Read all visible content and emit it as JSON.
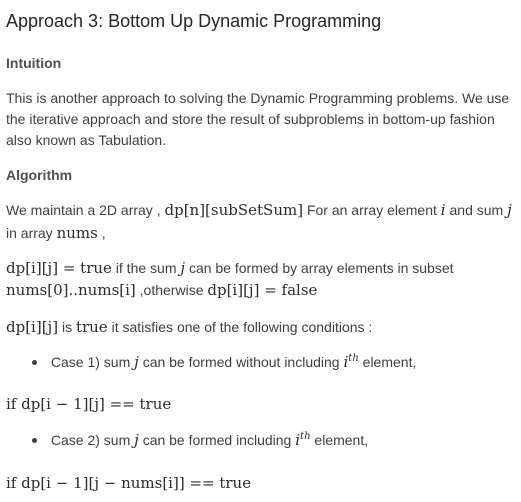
{
  "title": "Approach 3: Bottom Up Dynamic Programming",
  "intuition": {
    "heading": "Intuition",
    "paragraph": "This is another approach to solving the Dynamic Programming problems. We use the iterative approach and store the result of subproblems in bottom-up fashion also known as Tabulation."
  },
  "algorithm": {
    "heading": "Algorithm",
    "line1": {
      "prefix": "We maintain a 2D array , ",
      "math_dp": "dp[n][subSetSum]",
      "mid": " For an array element ",
      "var_i": "i",
      "and_sum": " and sum ",
      "var_j": "j"
    },
    "line2": {
      "prefix": "in array ",
      "nums": "nums",
      "suffix": ","
    },
    "def": {
      "lhs": "dp[i][j] = true",
      "text1": " if the sum ",
      "var_j": "j",
      "text2": " can be formed by array elements in subset",
      "subset": "nums[0]..nums[i]",
      "otherwise": ",otherwise ",
      "rhs": "dp[i][j] = false"
    },
    "cond": {
      "lhs": "dp[i][j]",
      "is": " is ",
      "true": "true",
      "text": " it satisfies one of the following conditions :"
    },
    "case1": {
      "prefix": "Case 1) sum ",
      "var_j": "j",
      "mid": " can be formed without including ",
      "i": "i",
      "th": "th",
      "suffix": " element,"
    },
    "if1": "if dp[i − 1][j] == true",
    "case2": {
      "prefix": "Case 2) sum ",
      "var_j": "j",
      "mid": " can be formed including ",
      "i": "i",
      "th": "th",
      "suffix": " element,"
    },
    "if2": "if dp[i − 1][j − nums[i]] == true"
  }
}
